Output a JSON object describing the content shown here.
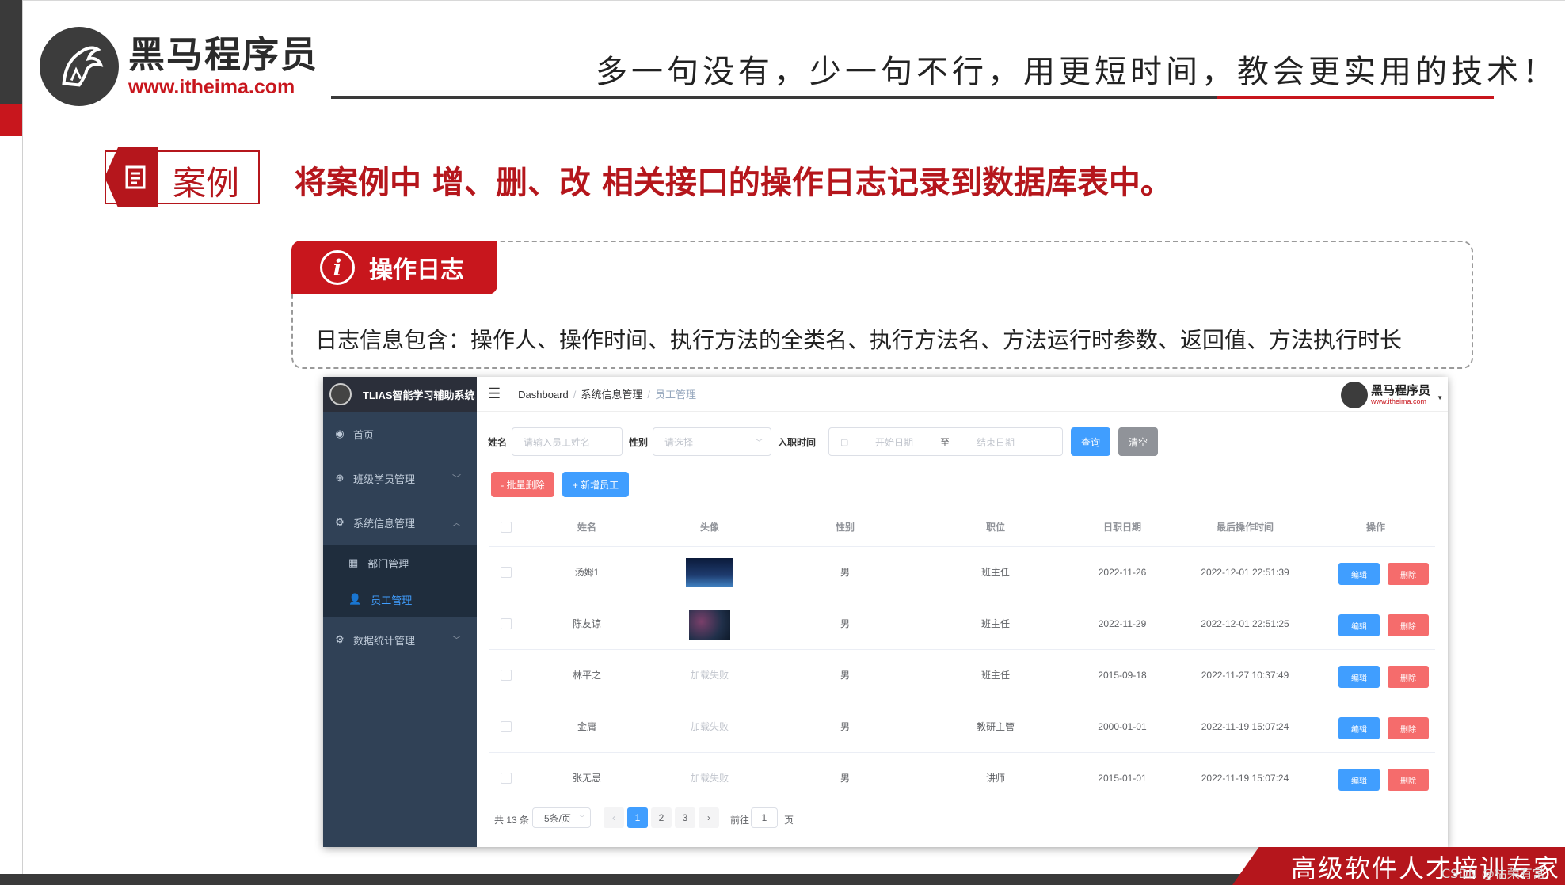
{
  "slide": {
    "logo_cn": "黑马程序员",
    "logo_url": "www.itheima.com",
    "slogan": "多一句没有，少一句不行，用更短时间，教会更实用的技术！",
    "case_label": "案例",
    "case_title": "将案例中 增、删、改 相关接口的操作日志记录到数据库表中。",
    "info_tab": "操作日志",
    "info_icon": "i",
    "info_text": "日志信息包含：操作人、操作时间、执行方法的全类名、执行方法名、方法运行时参数、返回值、方法执行时长",
    "footer_tag": "高级软件人才培训专家",
    "watermark": "CSDN @枯荣有常",
    "colors": {
      "brand_red": "#c8161d",
      "dark": "#3a3a3a"
    }
  },
  "app": {
    "title": "TLIAS智能学习辅助系统",
    "breadcrumb": [
      "Dashboard",
      "系统信息管理",
      "员工管理"
    ],
    "brand_cn": "黑马程序员",
    "brand_url": "www.itheima.com",
    "sidebar": {
      "home": "首页",
      "class_mgmt": "班级学员管理",
      "sys_mgmt": "系统信息管理",
      "dept_mgmt": "部门管理",
      "emp_mgmt": "员工管理",
      "stats_mgmt": "数据统计管理"
    },
    "search": {
      "name_label": "姓名",
      "name_placeholder": "请输入员工姓名",
      "gender_label": "性别",
      "gender_placeholder": "请选择",
      "date_label": "入职时间",
      "start_placeholder": "开始日期",
      "to": "至",
      "end_placeholder": "结束日期",
      "query_btn": "查询",
      "clear_btn": "清空"
    },
    "actions": {
      "batch_delete": "- 批量删除",
      "add": "+ 新增员工"
    },
    "table": {
      "headers": [
        "姓名",
        "头像",
        "性别",
        "职位",
        "日职日期",
        "最后操作时间",
        "操作"
      ],
      "rows": [
        {
          "name": "汤姆1",
          "avatar": "image",
          "gender": "男",
          "job": "班主任",
          "entry": "2022-11-26",
          "updated": "2022-12-01 22:51:39"
        },
        {
          "name": "陈友谅",
          "avatar": "image",
          "gender": "男",
          "job": "班主任",
          "entry": "2022-11-29",
          "updated": "2022-12-01 22:51:25"
        },
        {
          "name": "林平之",
          "avatar": "加载失败",
          "gender": "男",
          "job": "班主任",
          "entry": "2015-09-18",
          "updated": "2022-11-27 10:37:49"
        },
        {
          "name": "金庸",
          "avatar": "加载失败",
          "gender": "男",
          "job": "教研主管",
          "entry": "2000-01-01",
          "updated": "2022-11-19 15:07:24"
        },
        {
          "name": "张无忌",
          "avatar": "加载失败",
          "gender": "男",
          "job": "讲师",
          "entry": "2015-01-01",
          "updated": "2022-11-19 15:07:24"
        }
      ],
      "edit_label": "编辑",
      "delete_label": "删除"
    },
    "pagination": {
      "total": "共 13 条",
      "page_size": "5条/页",
      "pages": [
        "1",
        "2",
        "3"
      ],
      "goto_label": "前往",
      "goto_value": "1",
      "page_suffix": "页"
    },
    "colors": {
      "primary": "#409eff",
      "danger": "#f56c6c",
      "info": "#909399",
      "sidebar": "#304156"
    }
  }
}
